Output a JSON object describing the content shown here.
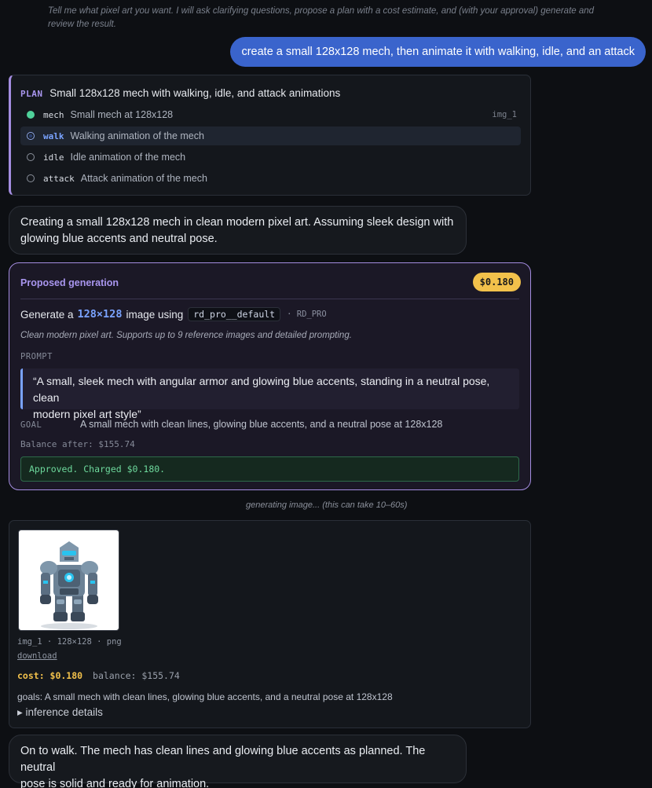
{
  "intro": "Tell me what pixel art you want. I will ask clarifying questions, propose a plan with a cost estimate, and (with your approval) generate and review the result.",
  "user_message": "create a small 128x128 mech, then animate it with walking, idle, and an attack",
  "plan": {
    "tag": "PLAN",
    "title": "Small 128x128 mech with walking, idle, and attack animations",
    "items": [
      {
        "key": "mech",
        "desc": "Small mech at 128x128",
        "ref": "img_1",
        "state": "done"
      },
      {
        "key": "walk",
        "desc": "Walking animation of the mech",
        "ref": "",
        "state": "current"
      },
      {
        "key": "idle",
        "desc": "Idle animation of the mech",
        "ref": "",
        "state": "pending"
      },
      {
        "key": "attack",
        "desc": "Attack animation of the mech",
        "ref": "",
        "state": "pending"
      }
    ]
  },
  "assistant_1": {
    "line1": "Creating a small 128x128 mech in clean modern pixel art. Assuming sleek design with",
    "line2": "glowing blue accents and neutral pose."
  },
  "proposal": {
    "title": "Proposed generation",
    "price": "$0.180",
    "gen_prefix": "Generate a",
    "size": "128×128",
    "gen_suffix": "image using",
    "model": "rd_pro__default",
    "model_meta": "· RD_PRO",
    "description": "Clean modern pixel art. Supports up to 9 reference images and detailed prompting.",
    "prompt_label": "PROMPT",
    "prompt_line1": "“A small, sleek mech with angular armor and glowing blue accents, standing in a neutral pose, clean",
    "prompt_line2": "modern pixel art style”",
    "goal_label": "GOAL",
    "goal": "A small mech with clean lines, glowing blue accents, and a neutral pose at 128x128",
    "balance_after": "Balance after: $155.74",
    "approved": "Approved. Charged $0.180."
  },
  "status": "generating image... (this can take 10–60s)",
  "result": {
    "meta": "img_1 · 128×128 · png",
    "download": "download",
    "cost": "cost: $0.180",
    "balance": "balance: $155.74",
    "goals": "goals: A small mech with clean lines, glowing blue accents, and a neutral pose at 128x128",
    "inference": "▸ inference details"
  },
  "assistant_2": {
    "line1": "On to walk. The mech has clean lines and glowing blue accents as planned. The neutral",
    "line2": "pose is solid and ready for animation."
  },
  "colors": {
    "accent_purple": "#a48de0",
    "user_blue": "#3a64cc",
    "price_yellow": "#f2c14b",
    "success_green": "#6ed99d",
    "done_green": "#4fd19a"
  }
}
